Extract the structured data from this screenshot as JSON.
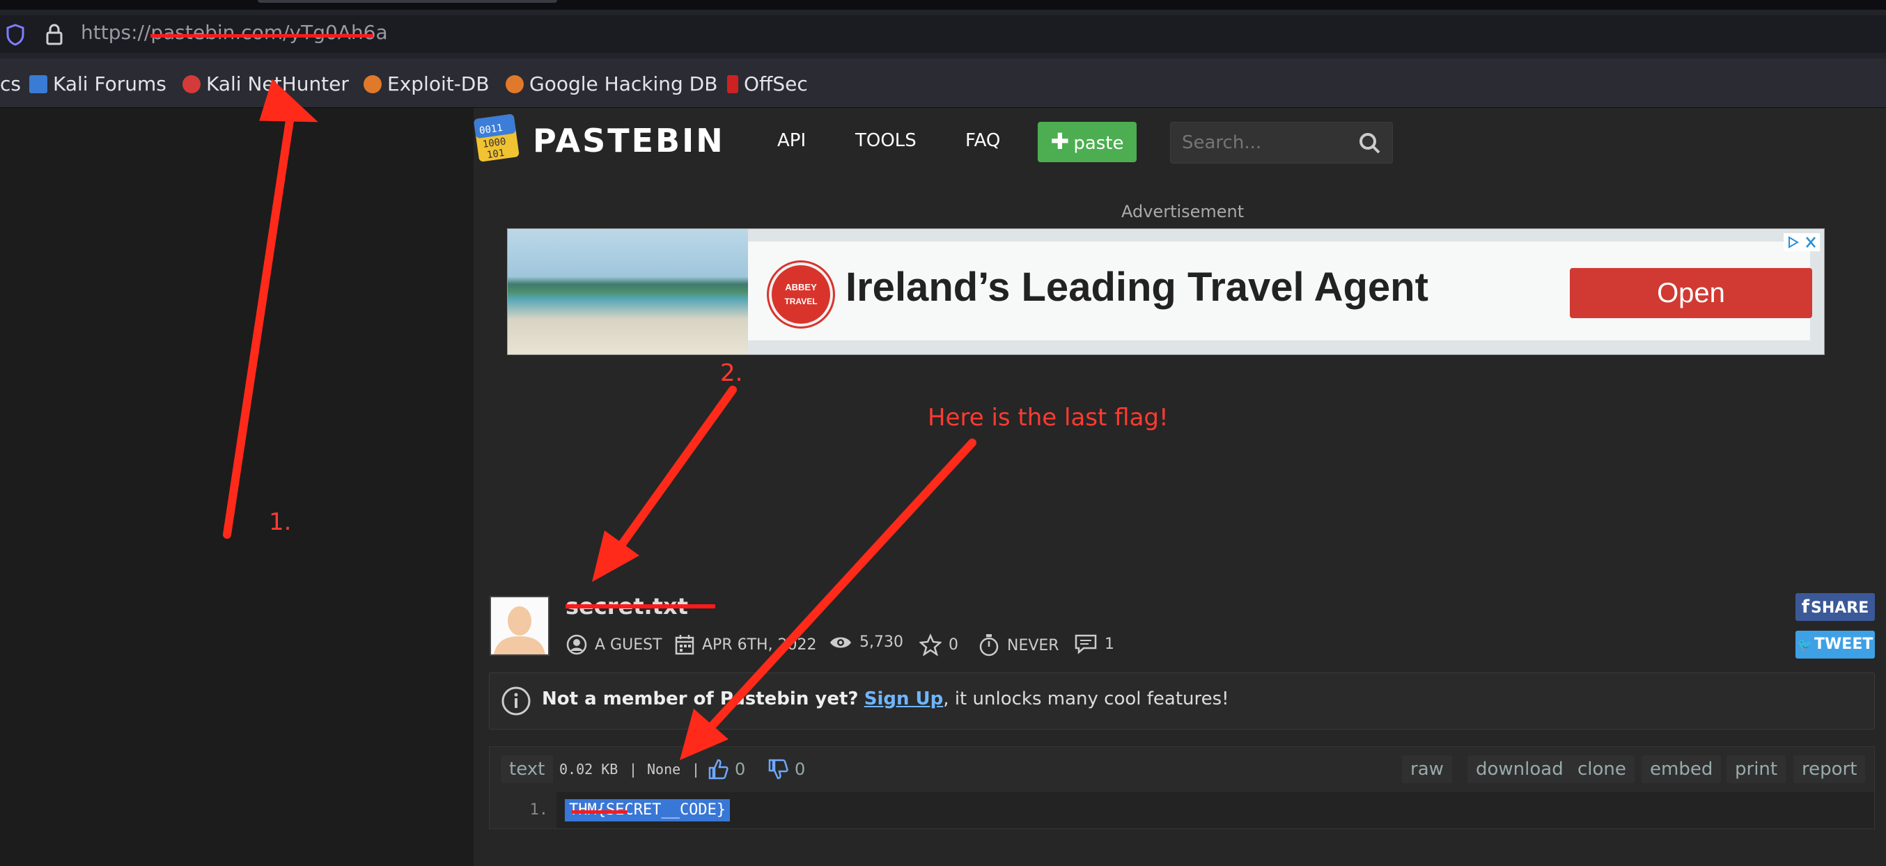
{
  "browser": {
    "url": "https://pastebin.com/yTg0Ah6a",
    "bookmarks": [
      {
        "label": "cs",
        "icon": "docs-icon"
      },
      {
        "label": "Kali Forums",
        "icon": "kali-forums-icon"
      },
      {
        "label": "Kali NetHunter",
        "icon": "nethunter-icon"
      },
      {
        "label": "Exploit-DB",
        "icon": "exploit-db-icon"
      },
      {
        "label": "Google Hacking DB",
        "icon": "ghdb-icon"
      },
      {
        "label": "OffSec",
        "icon": "offsec-icon"
      }
    ]
  },
  "header": {
    "logo_text": "PASTEBIN",
    "nav": [
      "API",
      "TOOLS",
      "FAQ"
    ],
    "paste_button": "paste",
    "search_placeholder": "Search..."
  },
  "ad": {
    "label": "Advertisement",
    "headline": "Ireland’s Leading Travel Agent",
    "button": "Open",
    "brand_logo": "ABBEY TRAVEL"
  },
  "annotations": {
    "one": "1.",
    "two": "2.",
    "flag_note": "Here is the last flag!"
  },
  "paste": {
    "title": "secret.txt",
    "author": "A GUEST",
    "date": "APR 6TH, 2022",
    "views": "5,730",
    "stars": "0",
    "expires": "NEVER",
    "comments": "1",
    "share_label": "SHARE",
    "tweet_label": "TWEET"
  },
  "notice": {
    "prefix": "Not a member of Pastebin yet?",
    "signup": "Sign Up",
    "suffix": ", it unlocks many cool features!"
  },
  "toolbar": {
    "syntax": "text",
    "size": "0.02 KB",
    "sep1": "|",
    "category": "None",
    "sep2": "|",
    "likes": "0",
    "dislikes": "0",
    "actions": [
      "raw",
      "download",
      "clone",
      "embed",
      "print",
      "report"
    ]
  },
  "code": {
    "line_number": "1.",
    "line_text": "THM{SECRET__CODE}"
  },
  "colors": {
    "annotation": "#ff3b30",
    "paste_button": "#4cae50",
    "ad_button": "#d03a32",
    "selection": "#3977d6"
  }
}
